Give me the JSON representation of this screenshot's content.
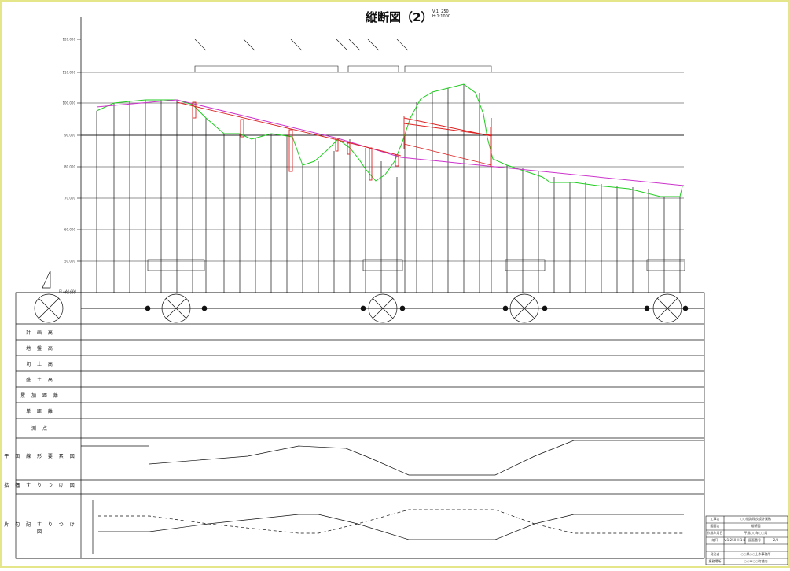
{
  "title": "縦断図（2）",
  "scale": {
    "vertical": "V:1: 250",
    "horizontal": "H:1:1000"
  },
  "elevation_ticks": [
    "120.000",
    "110.000",
    "100.000",
    "90.000",
    "80.000",
    "70.000",
    "60.000",
    "50.000",
    "40.000"
  ],
  "base_level": "EL=40.000",
  "rows": [
    {
      "label": "計 画 高"
    },
    {
      "label": "地 盤 高"
    },
    {
      "label": "切 土 高"
    },
    {
      "label": "盛 土 高"
    },
    {
      "label": "累 加 距 離"
    },
    {
      "label": "単 距 離"
    },
    {
      "label": "測 点"
    },
    {
      "label": "平 面 線 形 要 素 図"
    },
    {
      "label": "拡 幅 す り つ け 図"
    },
    {
      "label": "片 勾 配 す り つ け 図"
    }
  ],
  "title_block": {
    "project_name_label": "工事名",
    "project_name": "○○道路改良設計業務",
    "drawing_name_label": "図面名",
    "drawing_name": "縦断図",
    "date_label": "作成年月日",
    "date": "平成○○年○○月",
    "scale_label": "縮尺",
    "scale_value": "V:1:250 H:1:1000",
    "number_label": "図面番号",
    "number_value": "2/3",
    "org_label": "発注者",
    "org_value": "○○県○○土木事務所",
    "office_label": "業務場所",
    "office_value": "○○市○○町地内"
  },
  "colors": {
    "ground": "#22cc22",
    "plan": "#cc33cc",
    "structure": "#dd2222",
    "line": "#111111",
    "frame": "#e5e58a"
  }
}
